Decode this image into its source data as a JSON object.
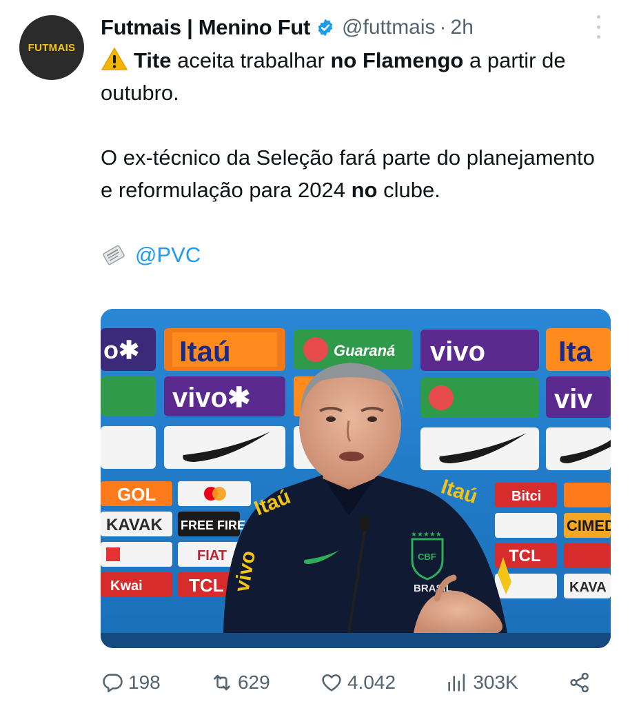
{
  "avatar": {
    "label": "FUTMAIS"
  },
  "author": {
    "display_name": "Futmais | Menino Fut",
    "handle": "@futtmais",
    "separator": "·",
    "time": "2h"
  },
  "tweet": {
    "line1_bold_a": "Tite",
    "line1_text_a": " aceita trabalhar ",
    "line1_bold_b": "no Flamengo",
    "line1_text_b": " a partir de outubro.",
    "para2_text": "O ex-técnico da Seleção fará parte do planejamento e reformulação para 2024 ",
    "para2_bold": "no",
    "para2_end": " clube.",
    "mention": "@PVC"
  },
  "media": {
    "boards": [
      "Itaú",
      "vivo",
      "Guaraná",
      "GOL",
      "KAVAK",
      "FREE FIRE",
      "FIAT",
      "TCL",
      "Kwai",
      "Bitci",
      "CIMED",
      "Mastercard"
    ],
    "jersey_sponsor": "Itaú",
    "jersey_sleeve": "vivo",
    "crest_text": "BRASIL",
    "colors": {
      "backdrop": "#1f7fcf",
      "jacket": "#101a33",
      "accent": "#f2c418"
    }
  },
  "stats": {
    "replies": "198",
    "reposts": "629",
    "likes": "4.042",
    "views": "303K"
  }
}
